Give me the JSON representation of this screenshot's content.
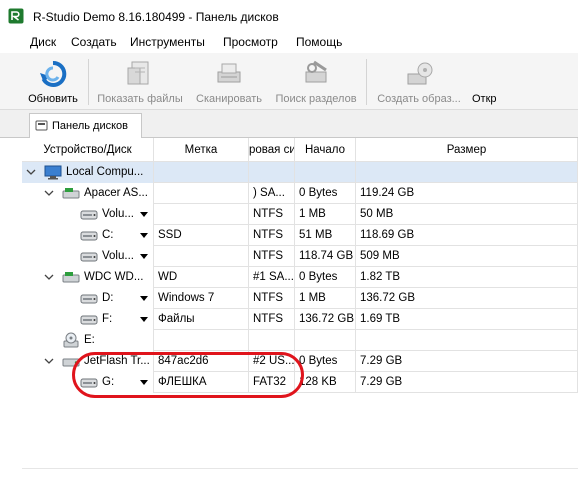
{
  "window": {
    "title": "R-Studio Demo 8.16.180499 - Панель дисков"
  },
  "menu": [
    "Диск",
    "Создать",
    "Инструменты",
    "Просмотр",
    "Помощь"
  ],
  "toolbar": {
    "buttons": [
      {
        "label": "Обновить",
        "icon": "refresh-icon",
        "enabled": true
      },
      {
        "label": "Показать файлы",
        "icon": "show-files-icon",
        "enabled": false
      },
      {
        "label": "Сканировать",
        "icon": "scan-icon",
        "enabled": false
      },
      {
        "label": "Поиск разделов",
        "icon": "search-partitions-icon",
        "enabled": false
      },
      {
        "label": "Создать образ...",
        "icon": "create-image-icon",
        "enabled": false
      },
      {
        "label": "Откр",
        "icon": "open-icon",
        "enabled": true
      }
    ]
  },
  "tab": {
    "label": "Панель дисков",
    "icon": "disk-panel-icon"
  },
  "columns": [
    "Устройство/Диск",
    "Метка",
    "ровая си",
    "Начало",
    "Размер"
  ],
  "rows": [
    {
      "name": "Local Compu...",
      "icon": "computer-icon",
      "label": "",
      "fs": "",
      "start": "",
      "size": "",
      "level": 0,
      "expander": true,
      "dropdown": false,
      "selected": true
    },
    {
      "name": "Apacer AS...",
      "icon": "ssd-drive-icon",
      "label": "",
      "fs": ") SA...",
      "start": "0 Bytes",
      "size": "119.24 GB",
      "level": 1,
      "expander": true,
      "dropdown": false,
      "selected": false
    },
    {
      "name": "Volu...",
      "icon": "volume-icon",
      "label": "",
      "fs": "NTFS",
      "start": "1 MB",
      "size": "50 MB",
      "level": 2,
      "expander": false,
      "dropdown": true,
      "selected": false
    },
    {
      "name": "C:",
      "icon": "volume-icon",
      "label": "SSD",
      "fs": "NTFS",
      "start": "51 MB",
      "size": "118.69 GB",
      "level": 2,
      "expander": false,
      "dropdown": true,
      "selected": false
    },
    {
      "name": "Volu...",
      "icon": "volume-icon",
      "label": "",
      "fs": "NTFS",
      "start": "118.74 GB",
      "size": "509 MB",
      "level": 2,
      "expander": false,
      "dropdown": true,
      "selected": false
    },
    {
      "name": "WDC WD...",
      "icon": "hdd-drive-icon",
      "label": "WD",
      "fs": "#1 SA...",
      "start": "0 Bytes",
      "size": "1.82 TB",
      "level": 1,
      "expander": true,
      "dropdown": false,
      "selected": false
    },
    {
      "name": "D:",
      "icon": "volume-icon",
      "label": "Windows 7",
      "fs": "NTFS",
      "start": "1 MB",
      "size": "136.72 GB",
      "level": 2,
      "expander": false,
      "dropdown": true,
      "selected": false
    },
    {
      "name": "F:",
      "icon": "volume-icon",
      "label": "Файлы",
      "fs": "NTFS",
      "start": "136.72 GB",
      "size": "1.69 TB",
      "level": 2,
      "expander": false,
      "dropdown": true,
      "selected": false
    },
    {
      "name": "E:",
      "icon": "cd-drive-icon",
      "label": "",
      "fs": "",
      "start": "",
      "size": "",
      "level": 1,
      "expander": false,
      "dropdown": false,
      "selected": false
    },
    {
      "name": "JetFlash Tr...",
      "icon": "usb-drive-icon",
      "label": "847ac2d6",
      "fs": "#2 US...",
      "start": "0 Bytes",
      "size": "7.29 GB",
      "level": 1,
      "expander": true,
      "dropdown": false,
      "selected": false
    },
    {
      "name": "G:",
      "icon": "volume-icon",
      "label": "ФЛЕШКА",
      "fs": "FAT32",
      "start": "128 KB",
      "size": "7.29 GB",
      "level": 2,
      "expander": false,
      "dropdown": true,
      "selected": false
    }
  ],
  "colors": {
    "selection": "#dce8f6",
    "highlight": "#e0141c",
    "toolbar_bg": "#f5f5f5"
  }
}
